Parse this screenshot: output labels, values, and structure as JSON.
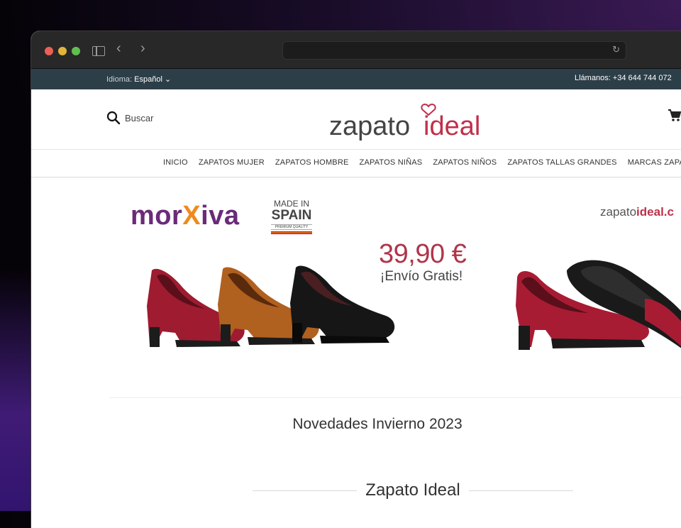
{
  "topbar": {
    "language_label": "Idioma:",
    "language_value": "Español",
    "phone": "Llámanos: +34 644 744 072"
  },
  "header": {
    "search_label": "Buscar",
    "logo_part1": "zapato",
    "logo_part2": "ideal"
  },
  "nav": {
    "items": [
      "INICIO",
      "ZAPATOS MUJER",
      "ZAPATOS HOMBRE",
      "ZAPATOS NIÑAS",
      "ZAPATOS NIÑOS",
      "ZAPATOS TALLAS GRANDES",
      "MARCAS ZAPATOS"
    ]
  },
  "banner": {
    "brand_part1": "mor",
    "brand_part2": "X",
    "brand_part3": "iva",
    "made_in_line1": "MADE IN",
    "made_in_line2": "SPAIN",
    "made_in_line3": "PREMIUM QUALITY",
    "price": "39,90 €",
    "shipping": "¡Envío Gratis!",
    "logo2_part1": "zapato",
    "logo2_part2": "ideal",
    "logo2_part3": ".c"
  },
  "sections": {
    "novedades": "Novedades Invierno 2023",
    "store_title": "Zapato Ideal"
  },
  "colors": {
    "topbar_bg": "#2c3e48",
    "brand_red": "#c0304a",
    "morxiva_purple": "#6b2a7a",
    "morxiva_orange": "#f08a1c"
  }
}
